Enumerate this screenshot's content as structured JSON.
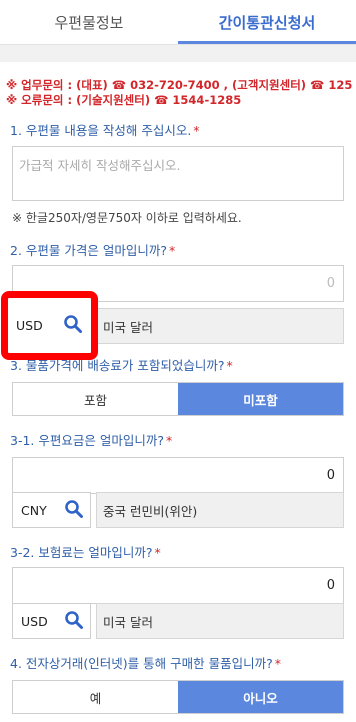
{
  "tabs": [
    {
      "label": "우편물정보",
      "active": false
    },
    {
      "label": "간이통관신청서",
      "active": true
    }
  ],
  "notice": {
    "line1": "※ 업무문의 : (대표) ☎ 032-720-7400 , (고객지원센터) ☎ 125",
    "line2": "※ 오류문의 : (기술지원센터) ☎ 1544-1285"
  },
  "q1": {
    "label": "1. 우편물 내용을 작성해 주십시오.",
    "required": "*",
    "placeholder": "가급적 자세히 작성해주십시오.",
    "hint": "※  한글250자/영문750자 이하로 입력하세요."
  },
  "q2": {
    "label": "2. 우편물 가격은 얼마입니까?",
    "required": "*",
    "value": "0",
    "currency_code": "USD",
    "currency_name": "미국 달러"
  },
  "q3": {
    "label": "3. 물품가격에 배송료가 포함되었습니까?",
    "required": "*",
    "options": [
      "포함",
      "미포함"
    ],
    "selected": "미포함"
  },
  "q3_1": {
    "label": "3-1. 우편요금은 얼마입니까?",
    "required": "*",
    "value": "0",
    "currency_code": "CNY",
    "currency_name": "중국 런민비(위안)"
  },
  "q3_2": {
    "label": "3-2. 보험료는 얼마입니까?",
    "required": "*",
    "value": "0",
    "currency_code": "USD",
    "currency_name": "미국 달러"
  },
  "q4": {
    "label": "4. 전자상거래(인터넷)를 통해 구매한 물품입니까?",
    "required": "*",
    "options": [
      "예",
      "아니오"
    ],
    "selected": "아니오"
  },
  "colors": {
    "accent": "#5b87de",
    "question": "#2f5fa8",
    "required": "#d3262a",
    "highlight": "#ff0000"
  },
  "icons": {
    "currency_search": "search-icon"
  }
}
